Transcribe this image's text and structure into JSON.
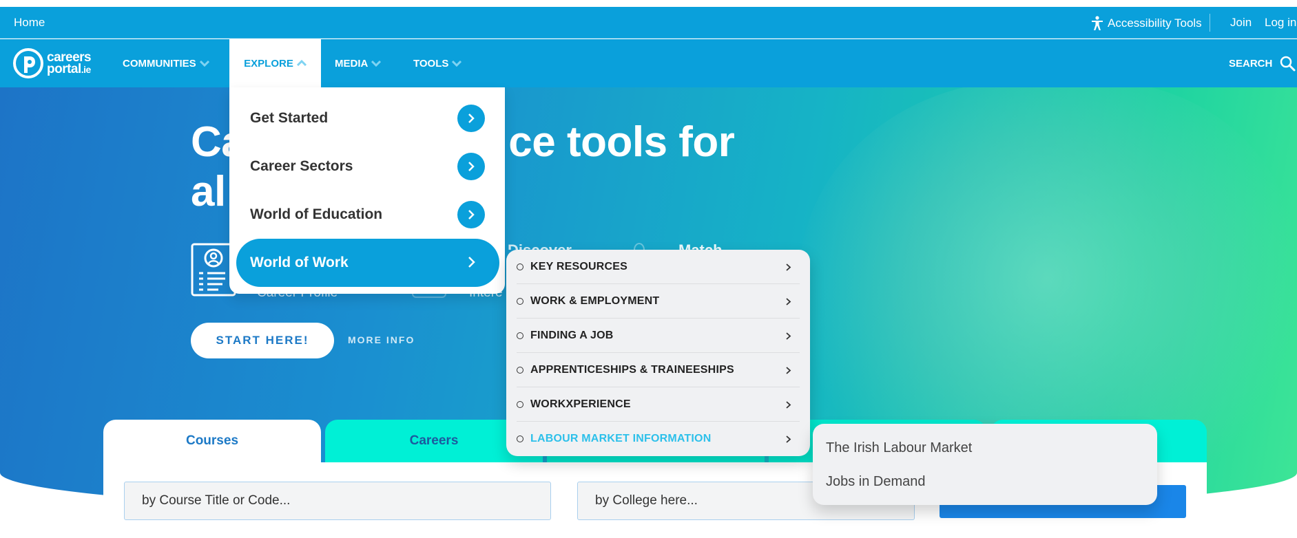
{
  "topbar": {
    "home": "Home",
    "accessibility": "Accessibility Tools",
    "join": "Join",
    "login": "Log in"
  },
  "logo": {
    "line1": "careers",
    "line2": "portal",
    "suffix": ".ie"
  },
  "nav": {
    "communities": "COMMUNITIES",
    "explore": "EXPLORE",
    "media": "MEDIA",
    "tools": "TOOLS",
    "search": "SEARCH"
  },
  "hero": {
    "title_start": "Ca",
    "title_end": "ce tools for",
    "title_line2": "al",
    "sub1": "Career Profile",
    "sub2": "Intere",
    "word1": "Discover",
    "word2": "Match",
    "start_button": "START HERE!",
    "more_info": "MORE INFO"
  },
  "explore_menu": {
    "items": [
      {
        "label": "Get Started"
      },
      {
        "label": "Career Sectors"
      },
      {
        "label": "World of Education"
      },
      {
        "label": "World of Work"
      }
    ]
  },
  "work_submenu": {
    "items": [
      {
        "label": "KEY RESOURCES"
      },
      {
        "label": "WORK & EMPLOYMENT"
      },
      {
        "label": "FINDING A JOB"
      },
      {
        "label": "APPRENTICESHIPS & TRAINEESHIPS"
      },
      {
        "label": "WORKXPERIENCE"
      },
      {
        "label": "LABOUR MARKET INFORMATION"
      }
    ]
  },
  "lmi_submenu": {
    "items": [
      {
        "label": "The Irish Labour Market"
      },
      {
        "label": "Jobs in Demand"
      }
    ]
  },
  "search": {
    "tabs": [
      {
        "label": "Courses"
      },
      {
        "label": "Careers"
      }
    ],
    "course_placeholder": "by Course Title or Code...",
    "college_placeholder": "by College here..."
  },
  "colors": {
    "brand_blue": "#0aa0db",
    "accent_teal": "#00f0d6",
    "active_link": "#2dc0ea",
    "button_blue": "#1a86e8"
  }
}
